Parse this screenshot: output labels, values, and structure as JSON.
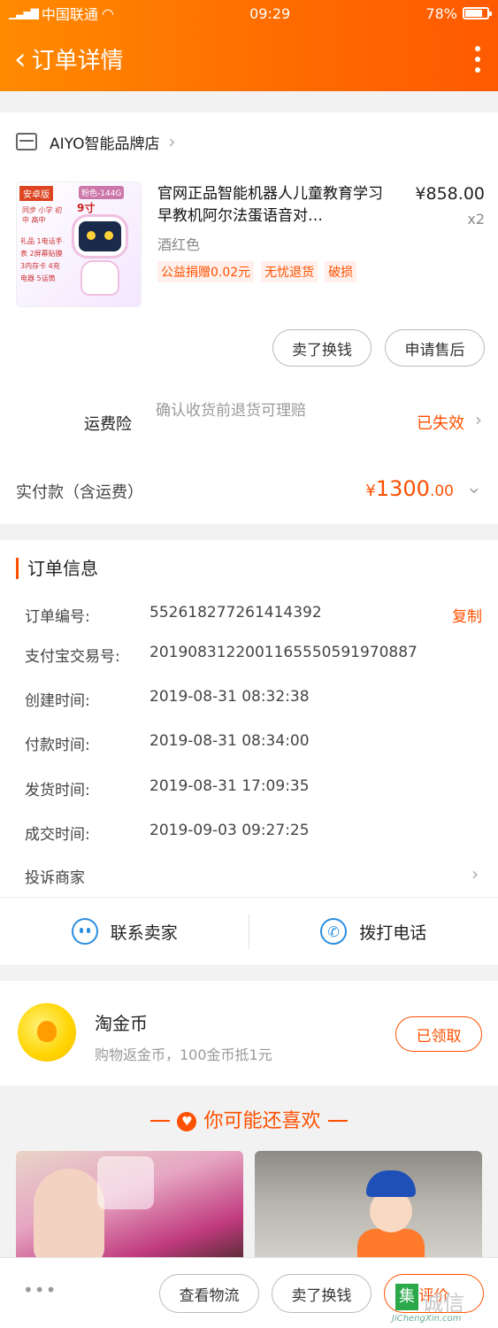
{
  "status_bar": {
    "carrier": "中国联通",
    "time": "09:29",
    "battery": "78%",
    "battery_level": 0.78
  },
  "nav": {
    "title": "订单详情"
  },
  "store": {
    "name": "AIYO智能品牌店"
  },
  "product": {
    "title": "官网正品智能机器人儿童教育学习早教机阿尔法蛋语音对…",
    "price": "¥858.00",
    "qty": "x2",
    "sku": "酒红色",
    "tags": [
      "公益捐赠0.02元",
      "无忧退货",
      "破损"
    ],
    "thumb_text": {
      "edition": "安卓版",
      "color": "粉色-144G",
      "screen": "9寸",
      "sync": "同步 小学 初中 高中",
      "gifts": "礼品 1电话手表 2屏幕贴膜 3内存卡 4充电器 5话筒"
    }
  },
  "actions": {
    "sell": "卖了换钱",
    "after_sale": "申请售后"
  },
  "insurance": {
    "label": "运费险",
    "desc": "确认收货前退货可理赔",
    "status": "已失效"
  },
  "paid": {
    "label": "实付款（含运费）",
    "symbol": "¥",
    "integer": "1300",
    "decimal": ".00"
  },
  "order_info": {
    "title": "订单信息",
    "rows": [
      {
        "k": "订单编号:",
        "v": "552618277261414392"
      },
      {
        "k": "支付宝交易号:",
        "v": "2019083122001165550591970887"
      },
      {
        "k": "创建时间:",
        "v": "2019-08-31 08:32:38"
      },
      {
        "k": "付款时间:",
        "v": "2019-08-31 08:34:00"
      },
      {
        "k": "发货时间:",
        "v": "2019-08-31 17:09:35"
      },
      {
        "k": "成交时间:",
        "v": "2019-09-03 09:27:25"
      }
    ],
    "copy": "复制",
    "complain": "投诉商家",
    "contact_seller": "联系卖家",
    "call": "拨打电话"
  },
  "coin": {
    "title": "淘金币",
    "sub": "购物返金币，100金币抵1元",
    "button": "已领取"
  },
  "recommend": {
    "title": "你可能还喜欢"
  },
  "bottom": {
    "more": "•••",
    "logistics": "查看物流",
    "sell": "卖了换钱",
    "review": "评价"
  },
  "watermark": {
    "char": "集",
    "word": "诚信",
    "url": "JiChengXin.com"
  }
}
